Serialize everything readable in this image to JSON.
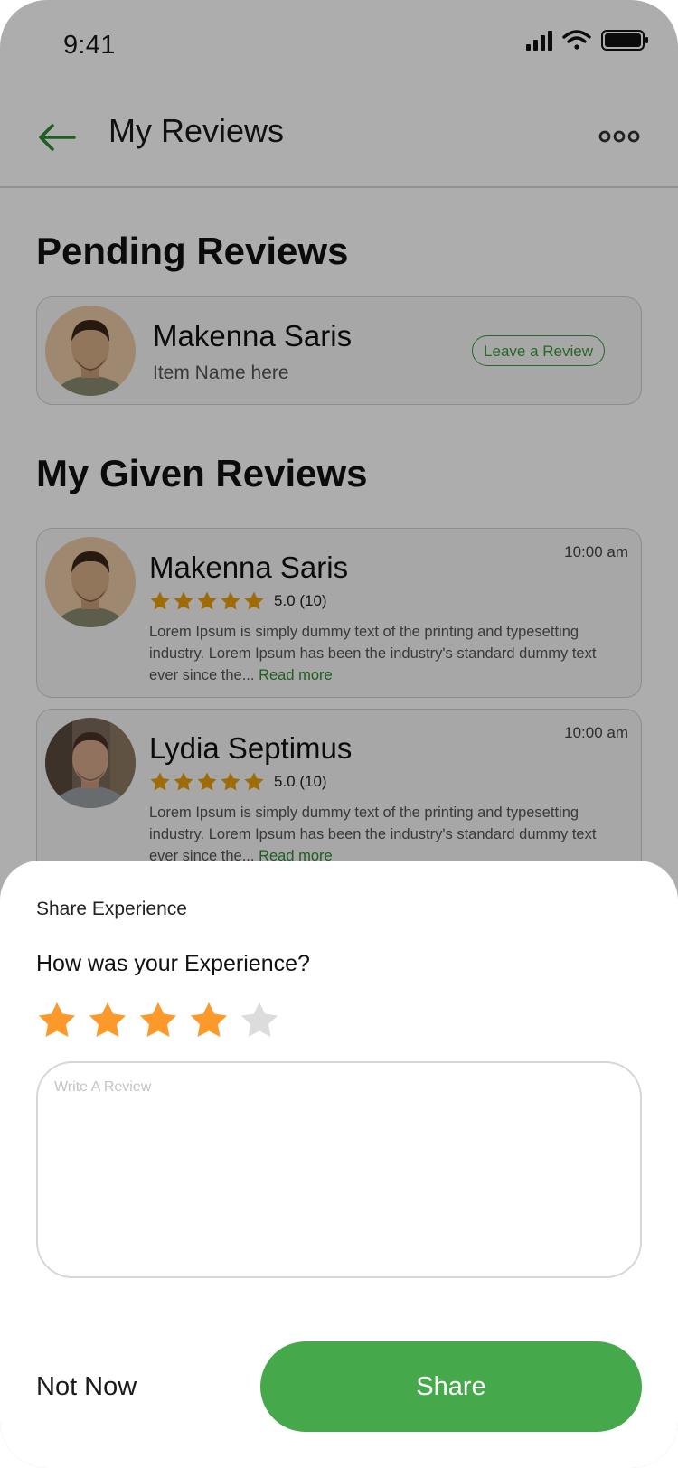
{
  "status_bar": {
    "time": "9:41"
  },
  "header": {
    "title": "My Reviews"
  },
  "pending": {
    "section_title": "Pending Reviews",
    "name": "Makenna Saris",
    "item": "Item Name here",
    "action_label": "Leave a Review"
  },
  "given": {
    "section_title": "My Given Reviews",
    "reviews": [
      {
        "name": "Makenna Saris",
        "time": "10:00 am",
        "score": "5.0 (10)",
        "text": "Lorem Ipsum is simply dummy text of the printing and typesetting industry. Lorem Ipsum has been the industry's standard dummy text ever since the...",
        "read_more": "Read more"
      },
      {
        "name": "Lydia Septimus",
        "time": "10:00 am",
        "score": "5.0 (10)",
        "text": "Lorem Ipsum is simply dummy text of the printing and typesetting industry. Lorem Ipsum has been the industry's standard dummy text ever since the...",
        "read_more": "Read more"
      }
    ]
  },
  "sheet": {
    "label": "Share Experience",
    "question": "How was your Experience?",
    "rating": 4,
    "rating_max": 5,
    "review_placeholder": "Write A Review",
    "not_now_label": "Not Now",
    "share_label": "Share"
  },
  "colors": {
    "accent_green": "#45a84a",
    "star_gold": "#e8a00c",
    "star_orange": "#fb9a2a",
    "star_empty": "#dcdcdc"
  },
  "icons": [
    "back-arrow-icon",
    "more-dots-icon",
    "signal-icon",
    "wifi-icon",
    "battery-icon",
    "star-icon"
  ]
}
